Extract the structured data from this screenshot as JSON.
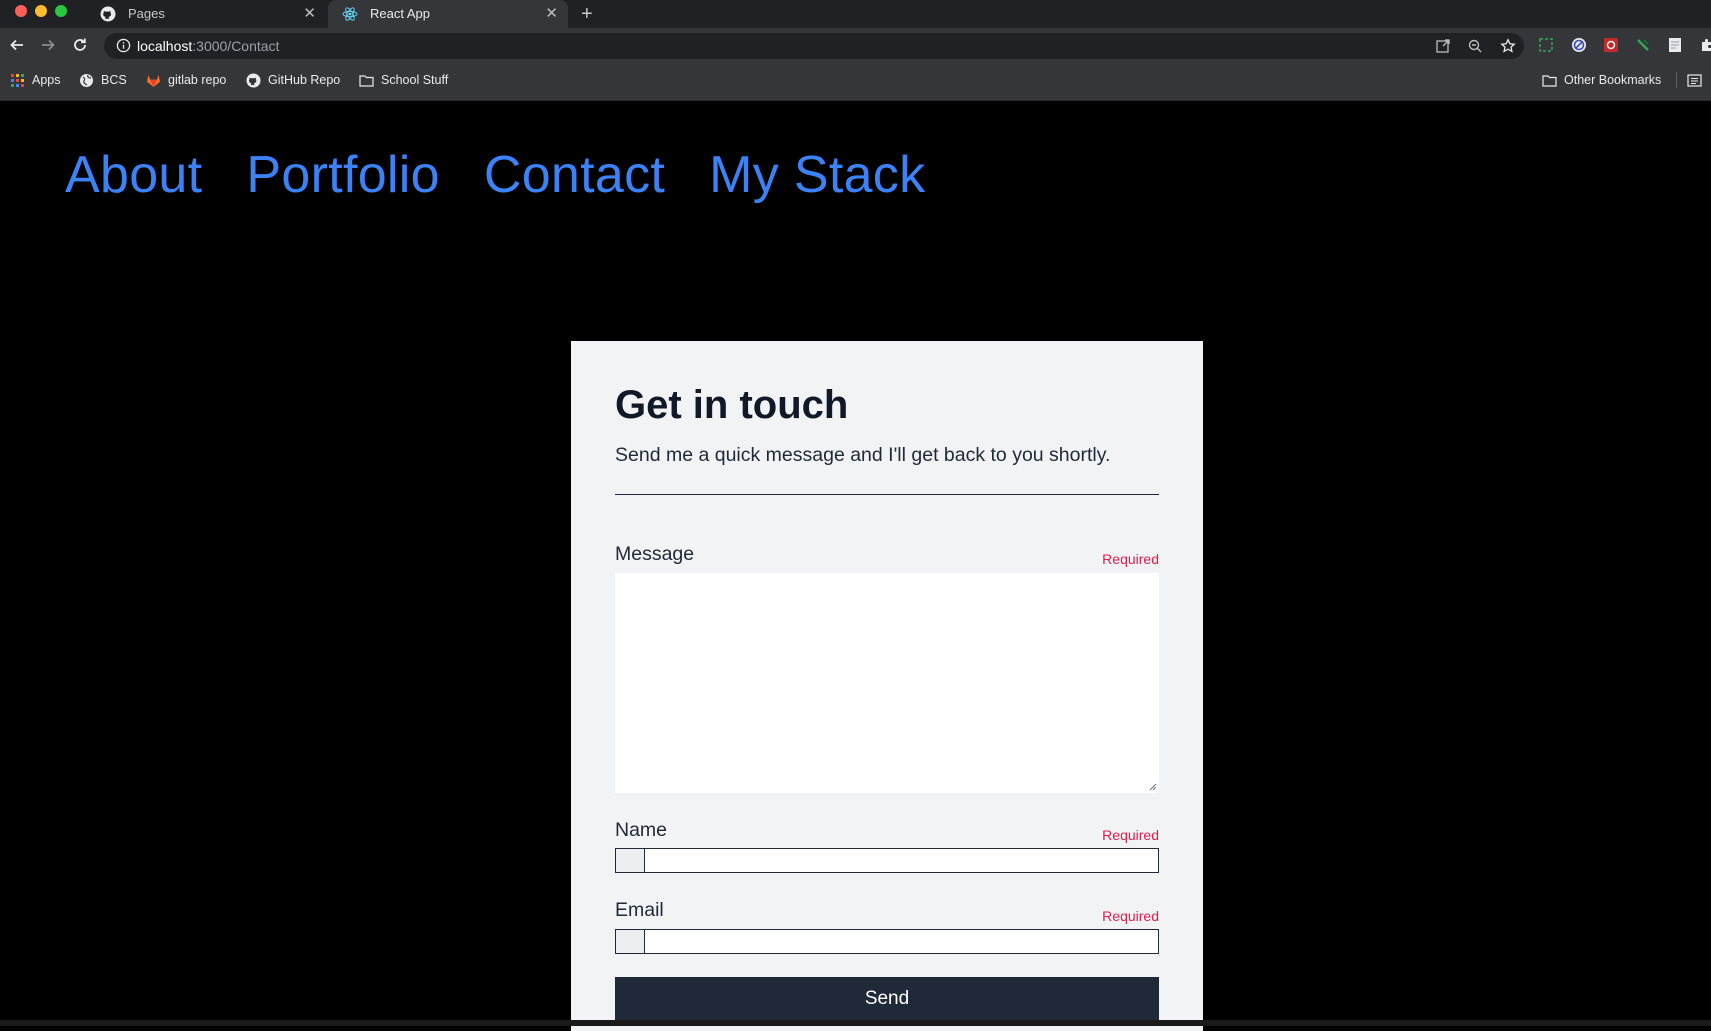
{
  "browser": {
    "tabs": [
      {
        "title": "Pages",
        "icon": "github-icon"
      },
      {
        "title": "React App",
        "icon": "react-icon"
      }
    ],
    "url_host": "localhost",
    "url_path": ":3000/Contact",
    "bookmarks": [
      "Apps",
      "BCS",
      "gitlab repo",
      "GitHub Repo",
      "School Stuff"
    ],
    "other_bookmarks": "Other Bookmarks"
  },
  "nav": {
    "items": [
      "About",
      "Portfolio",
      "Contact",
      "My Stack"
    ],
    "color": "#3b82f6"
  },
  "contact": {
    "title": "Get in touch",
    "subtitle": "Send me a quick message and I'll get back to you shortly.",
    "message_label": "Message",
    "name_label": "Name",
    "email_label": "Email",
    "required_text": "Required",
    "message_value": "",
    "name_value": "",
    "email_value": "",
    "send_label": "Send",
    "required_color": "#e11d48"
  }
}
